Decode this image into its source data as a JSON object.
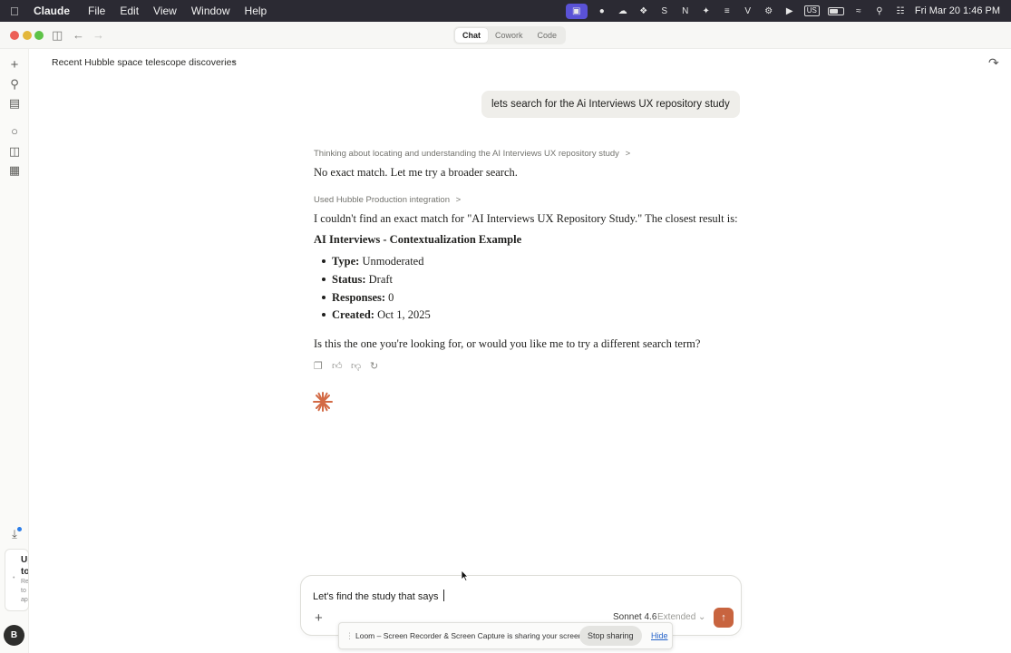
{
  "menubar": {
    "apple_icon": "apple-logo-icon",
    "app_name": "Claude",
    "menus": [
      "File",
      "Edit",
      "View",
      "Window",
      "Help"
    ],
    "status_icons": [
      "screen-record-icon",
      "zoom-icon",
      "cloud-icon",
      "dropbox-icon",
      "skype-icon",
      "notion-icon",
      "slack-icon",
      "tally-icon",
      "vectorworks-icon",
      "gear-icon",
      "play-icon"
    ],
    "keyboard_input": "US",
    "clock": "Fri Mar 20  1:46 PM"
  },
  "window": {
    "mode_tabs": [
      "Chat",
      "Cowork",
      "Code"
    ],
    "active_mode": "Chat"
  },
  "conversation": {
    "title": "Recent Hubble space telescope discoveries"
  },
  "user_message": "lets search for the Ai Interviews UX repository study",
  "assistant": {
    "thought_label": "Thinking about locating and understanding the AI Interviews UX repository study",
    "thought_chevron": ">",
    "line1": "No exact match. Let me try a broader search.",
    "tool_label": "Used Hubble Production integration",
    "tool_chevron": ">",
    "line2": "I couldn't find an exact match for \"AI Interviews UX Repository Study.\" The closest result is:",
    "result_title": "AI Interviews - Contextualization Example",
    "details": [
      {
        "label": "Type:",
        "value": "Unmoderated"
      },
      {
        "label": "Status:",
        "value": "Draft"
      },
      {
        "label": "Responses:",
        "value": "0"
      },
      {
        "label": "Created:",
        "value": "Oct 1, 2025"
      }
    ],
    "question": "Is this the one you're looking for, or would you like me to try a different search term?"
  },
  "sidebar": {
    "promo_title": "Up",
    "promo_title_2": "to",
    "promo_body": [
      "Re",
      "to",
      "ap"
    ],
    "avatar_initial": "B"
  },
  "composer": {
    "input_value": "Let's find the study that says ",
    "model": "Sonnet 4.6",
    "mode": "Extended"
  },
  "loom": {
    "message": "Loom – Screen Recorder & Screen Capture is sharing your screen.",
    "stop_label": "Stop sharing",
    "hide_label": "Hide"
  },
  "colors": {
    "accent_send": "#c8643f",
    "spark": "#d36a45",
    "menubar_bg": "#2b2a33",
    "user_bubble": "#efeeea"
  }
}
